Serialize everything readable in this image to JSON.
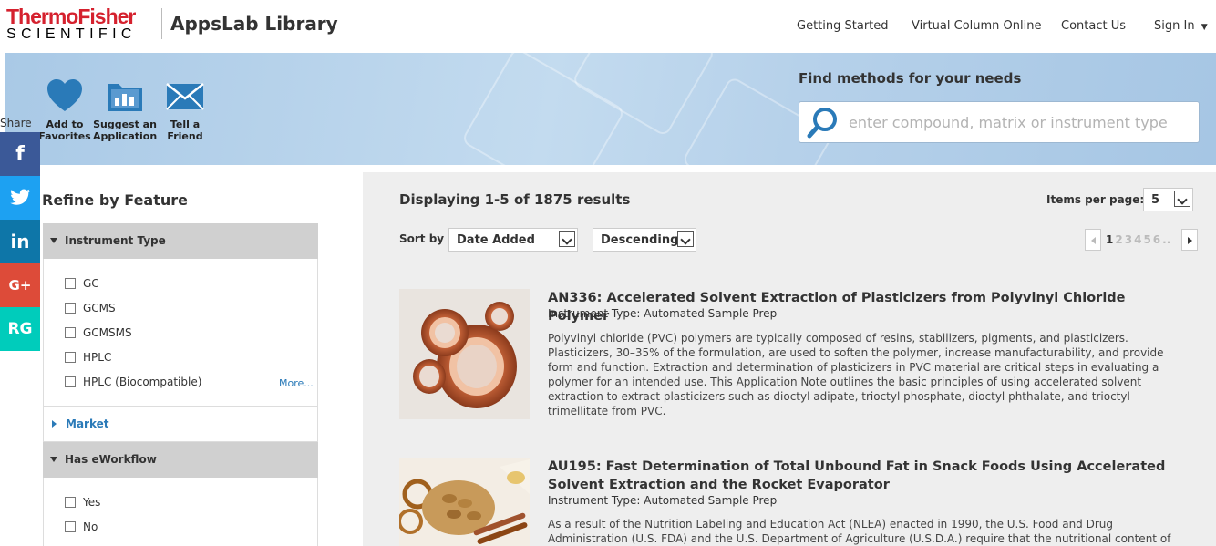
{
  "header": {
    "logo_line1": "ThermoFisher",
    "logo_line2": "SCIENTIFIC",
    "app_title": "AppsLab Library",
    "nav": [
      "Getting Started",
      "Virtual Column Online",
      "Contact Us",
      "Sign In"
    ]
  },
  "banner": {
    "actions": [
      {
        "label1": "Add to",
        "label2": "Favorites",
        "icon": "heart-icon"
      },
      {
        "label1": "Suggest an",
        "label2": "Application",
        "icon": "folder-chart-icon"
      },
      {
        "label1": "Tell a",
        "label2": "Friend",
        "icon": "envelope-icon"
      }
    ],
    "find_title": "Find methods for your needs",
    "search_placeholder": "enter compound, matrix or instrument type"
  },
  "share": {
    "label": "Share",
    "buttons": [
      {
        "label": "f",
        "icon": "facebook-icon",
        "color": "#3b5998"
      },
      {
        "label": "t",
        "icon": "twitter-icon",
        "color": "#1da1f2"
      },
      {
        "label": "in",
        "icon": "linkedin-icon",
        "color": "#0e76a8"
      },
      {
        "label": "G+",
        "icon": "google-plus-icon",
        "color": "#dd4b39"
      },
      {
        "label": "RG",
        "icon": "researchgate-icon",
        "color": "#00ccbb"
      }
    ]
  },
  "refine": {
    "title": "Refine by Feature",
    "facets": {
      "instrument_type": {
        "label": "Instrument Type",
        "options": [
          "GC",
          "GCMS",
          "GCMSMS",
          "HPLC",
          "HPLC (Biocompatible)"
        ],
        "more": "More..."
      },
      "market": {
        "label": "Market"
      },
      "eworkflow": {
        "label": "Has eWorkflow",
        "options": [
          "Yes",
          "No"
        ]
      }
    }
  },
  "results": {
    "count_text": "Displaying 1-5 of 1875 results",
    "items_per_page_label": "Items per page:",
    "items_per_page": "5",
    "sort_label": "Sort by",
    "sort_field": "Date Added",
    "sort_order": "Descending",
    "pages": [
      "1",
      "2",
      "3",
      "4",
      "5",
      "6",
      ".."
    ],
    "items": [
      {
        "title": "AN336: Accelerated Solvent Extraction of Plasticizers from Polyvinyl Chloride Polymer",
        "meta": "Instrument Type: Automated Sample Prep",
        "desc": "Polyvinyl chloride (PVC) polymers are typically composed of resins, stabilizers, pigments, and plasticizers. Plasticizers, 30–35% of the formulation, are used to soften the polymer, increase manufacturability, and provide form and function. Extraction and determination of plasticizers in PVC material are critical steps in evaluating a polymer for an intended use. This Application Note outlines the basic principles of using accelerated solvent extraction to extract plasticizers such as dioctyl adipate, trioctyl phosphate, dioctyl phthalate, and trioctyl trimellitate from PVC."
      },
      {
        "title": "AU195: Fast Determination of Total Unbound Fat in Snack Foods Using Accelerated Solvent Extraction and the Rocket Evaporator",
        "meta": "Instrument Type: Automated Sample Prep",
        "desc": "As a result of the Nutrition Labeling and Education Act (NLEA) enacted in 1990, the U.S. Food and Drug Administration (U.S. FDA) and the U.S. Department of Agriculture (U.S.D.A.) require that the nutritional content of processed and packaged food"
      }
    ]
  }
}
